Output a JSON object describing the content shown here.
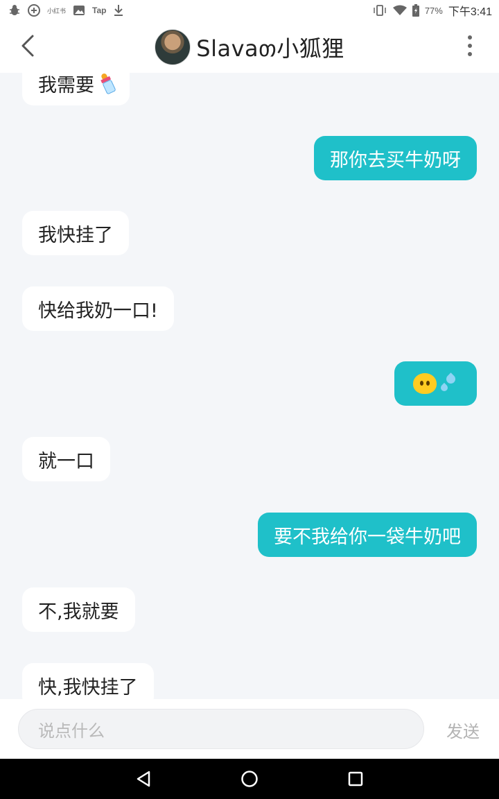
{
  "status_bar": {
    "left_icons": [
      "bug-icon",
      "plus-circle-icon",
      "app-label-icon",
      "image-icon",
      "tap-app-icon",
      "download-icon"
    ],
    "app_label_text": "小红书",
    "tap_text": "Tap",
    "battery": "77%",
    "time": "下午3:41"
  },
  "header": {
    "title": "Slavaთ小狐狸"
  },
  "messages": [
    {
      "side": "in",
      "text": "我需要",
      "extra": "baby-bottle-emoji"
    },
    {
      "side": "out",
      "text": "那你去买牛奶呀"
    },
    {
      "side": "in",
      "text": "我快挂了"
    },
    {
      "side": "in",
      "text": "快给我奶一口!"
    },
    {
      "side": "out",
      "text": "",
      "extra": "sweat-face-emoji"
    },
    {
      "side": "in",
      "text": "就一口"
    },
    {
      "side": "out",
      "text": "要不我给你一袋牛奶吧"
    },
    {
      "side": "in",
      "text": "不,我就要"
    },
    {
      "side": "in",
      "text": "快,我快挂了"
    }
  ],
  "input": {
    "placeholder": "说点什么",
    "send_label": "发送"
  },
  "colors": {
    "outgoing_bubble": "#1fc0c9",
    "incoming_bubble": "#ffffff",
    "background": "#f4f6f9"
  }
}
